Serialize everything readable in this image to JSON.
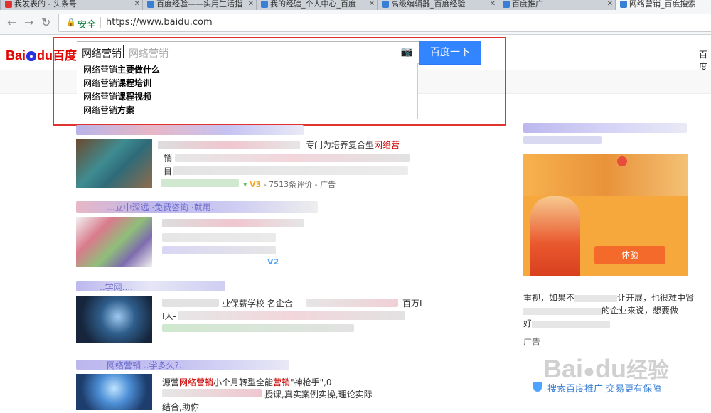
{
  "browser": {
    "tabs": [
      {
        "label": "我发表的 - 头条号",
        "active": false,
        "fav_color": "#e0322f"
      },
      {
        "label": "百度经验——实用生活指",
        "active": false,
        "fav_color": "#3a7fd6"
      },
      {
        "label": "我的经验_个人中心_百度",
        "active": false,
        "fav_color": "#3a7fd6"
      },
      {
        "label": "高级编辑器_百度经验",
        "active": false,
        "fav_color": "#3a7fd6"
      },
      {
        "label": "百度推广",
        "active": false,
        "fav_color": "#3a7fd6"
      },
      {
        "label": "网络营销_百度搜索",
        "active": true,
        "fav_color": "#3a7fd6"
      }
    ],
    "secure_label": "安全",
    "url": "https://www.baidu.com"
  },
  "logo": {
    "text_a": "Bai",
    "text_b": "du",
    "text_cn": "百度"
  },
  "search": {
    "query": "网络营销",
    "ghost_text": "网络营销",
    "button_label": "百度一下",
    "suggestions": [
      {
        "prefix": "网络营销",
        "suffix": "主要做什么"
      },
      {
        "prefix": "网络营销",
        "suffix": "课程培训"
      },
      {
        "prefix": "网络营销",
        "suffix": "课程视频"
      },
      {
        "prefix": "网络营销",
        "suffix": "方案"
      }
    ]
  },
  "header": {
    "right_link": "百度"
  },
  "results": {
    "r1": {
      "snippet_tail_a": "专门为培养复合型",
      "snippet_tail_b": "网络营",
      "line2_start": "销",
      "line3_start": "目,",
      "rating": "7513条评价",
      "ad_label": "广告",
      "v_badge": "V3"
    },
    "r2": {
      "title_visible": "...立中深远 ·免费咨询 ·就用...",
      "v_badge": "V2"
    },
    "r3": {
      "title_visible": "..学网....",
      "snippet_a": "业保薪学校 名企合",
      "snippet_b": "百万I",
      "snippet_c": "I人-"
    },
    "r4": {
      "title_visible": "网络营销 ..学多久?...",
      "snippet_a": "源营",
      "snippet_brand": "网络营销",
      "snippet_b": "小个月转型全能",
      "snippet_kw": "营销",
      "snippet_c": "\"神枪手\",0",
      "snippet_d": "授课,真实案例实操,理论实际",
      "snippet_e": "结合,助你"
    }
  },
  "sidebar": {
    "text_a": "重视，如果不",
    "text_b": "让开展，也很难中肾",
    "text_c": "的企业来说，想要做",
    "text_d": "好",
    "ad_label": "广告",
    "ad_badge": "体验"
  },
  "guarantee": {
    "text": "搜索百度推广 交易更有保障"
  },
  "watermark": {
    "text": "Bai",
    "text2": "du",
    "text_cn": "经验"
  }
}
